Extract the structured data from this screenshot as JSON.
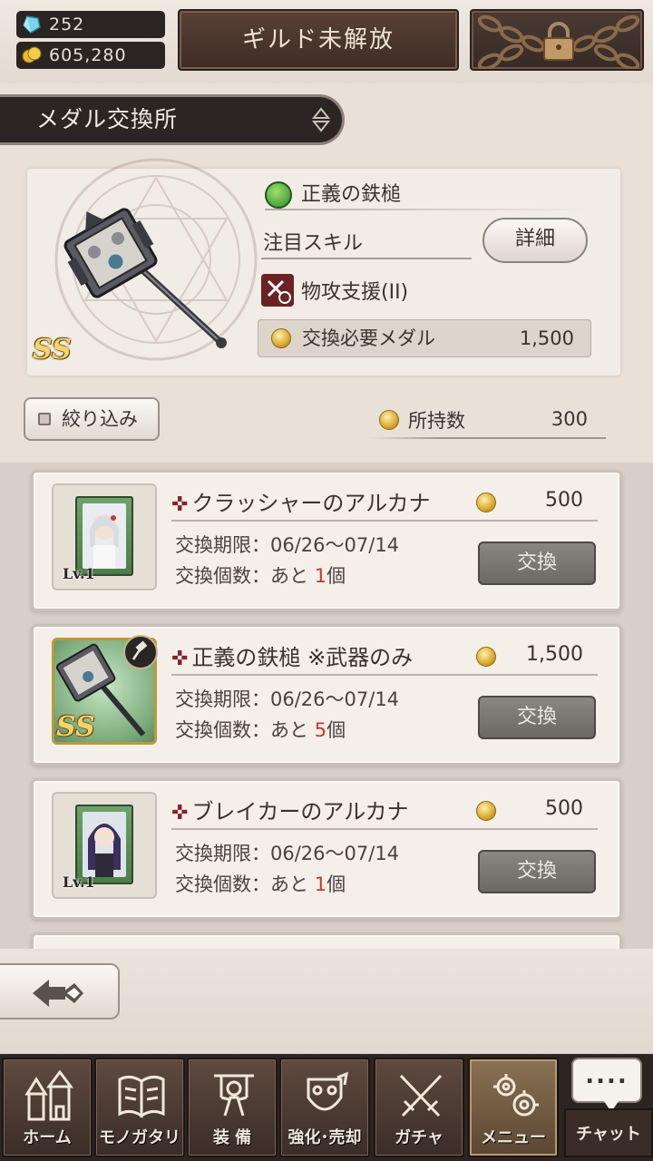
{
  "currency": {
    "gems": "252",
    "gold": "605,280"
  },
  "header": {
    "guild_label": "ギルド未解放"
  },
  "page_title": "メダル交換所",
  "featured": {
    "name": "正義の鉄槌",
    "rank": "SS",
    "skill_heading": "注目スキル",
    "detail_label": "詳細",
    "skill_name": "物攻支援(II)",
    "required_label": "交換必要メダル",
    "required_value": "1,500"
  },
  "filter_label": "絞り込み",
  "owned": {
    "label": "所持数",
    "value": "300"
  },
  "items": [
    {
      "title": "クラッシャーのアルカナ",
      "price": "500",
      "period": "交換期限：06/26〜07/14",
      "count_prefix": "交換個数：あと ",
      "count_num": "1",
      "count_suffix": "個",
      "level": "Lv.1",
      "exchange_label": "交換"
    },
    {
      "title": "正義の鉄槌 ※武器のみ",
      "price": "1,500",
      "period": "交換期限：06/26〜07/14",
      "count_prefix": "交換個数：あと ",
      "count_num": "5",
      "count_suffix": "個",
      "rank": "SS",
      "exchange_label": "交換"
    },
    {
      "title": "ブレイカーのアルカナ",
      "price": "500",
      "period": "交換期限：06/26〜07/14",
      "count_prefix": "交換個数：あと ",
      "count_num": "1",
      "count_suffix": "個",
      "level": "Lv.1",
      "exchange_label": "交換"
    }
  ],
  "nav": [
    {
      "label": "ホーム",
      "icon": "castle-icon"
    },
    {
      "label": "モノガタリ",
      "icon": "book-icon"
    },
    {
      "label": "装 備",
      "icon": "puppet-icon"
    },
    {
      "label": "強化･売却",
      "icon": "mask-icon"
    },
    {
      "label": "ガチャ",
      "icon": "crossed-swords-icon"
    },
    {
      "label": "メニュー",
      "icon": "gears-icon"
    },
    {
      "label": "チャット",
      "icon": "chat-icon"
    }
  ],
  "chat_dots": "....",
  "colors": {
    "accent_red": "#c23b2a",
    "medal_gold": "#d9a82c",
    "active_nav": "#8a7253"
  }
}
